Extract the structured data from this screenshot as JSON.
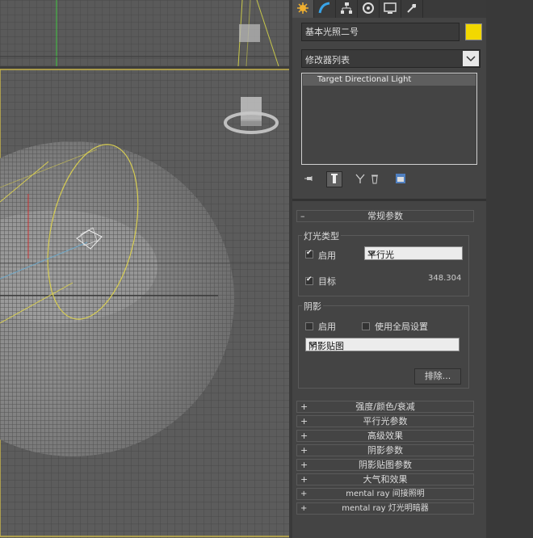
{
  "command_tabs": [
    {
      "icon": "create-icon",
      "active": true
    },
    {
      "icon": "modify-icon",
      "active": false
    },
    {
      "icon": "hierarchy-icon",
      "active": false
    },
    {
      "icon": "motion-icon",
      "active": false
    },
    {
      "icon": "display-icon",
      "active": false
    },
    {
      "icon": "utilities-icon",
      "active": false
    }
  ],
  "object": {
    "name": "基本光照二号",
    "color": "#f2d800"
  },
  "modifier_list": {
    "label": "修改器列表"
  },
  "stack": {
    "items": [
      "Target Directional Light"
    ]
  },
  "general_params": {
    "title": "常规参数",
    "toggle": "–",
    "light_type": {
      "title": "灯光类型",
      "enabled_label": "启用",
      "enabled": true,
      "type_value": "平行光",
      "target_label": "目标",
      "target": true,
      "target_distance": "348.304"
    },
    "shadows": {
      "title": "阴影",
      "enabled_label": "启用",
      "enabled": false,
      "global_label": "使用全局设置",
      "global": false,
      "shadow_type": "阴影贴图",
      "exclude_label": "排除..."
    }
  },
  "rollouts": [
    {
      "toggle": "+",
      "label": "强度/颜色/衰减"
    },
    {
      "toggle": "+",
      "label": "平行光参数"
    },
    {
      "toggle": "+",
      "label": "高级效果"
    },
    {
      "toggle": "+",
      "label": "阴影参数"
    },
    {
      "toggle": "+",
      "label": "阴影贴图参数"
    },
    {
      "toggle": "+",
      "label": "大气和效果"
    },
    {
      "toggle": "+",
      "label": "mental ray 间接照明"
    },
    {
      "toggle": "+",
      "label": "mental ray 灯光明暗器"
    }
  ]
}
